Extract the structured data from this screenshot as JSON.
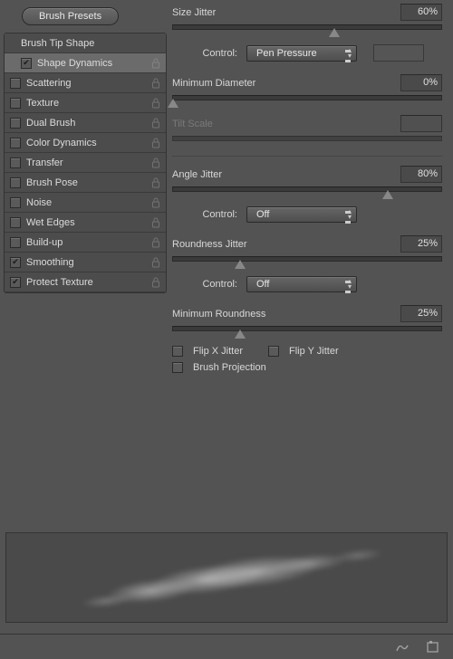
{
  "header": {
    "brush_presets": "Brush Presets"
  },
  "sidebar": {
    "tip_shape": "Brush Tip Shape",
    "items": [
      {
        "label": "Shape Dynamics",
        "checked": true,
        "selected": true,
        "lockable": true
      },
      {
        "label": "Scattering",
        "checked": false,
        "selected": false,
        "lockable": true
      },
      {
        "label": "Texture",
        "checked": false,
        "selected": false,
        "lockable": true
      },
      {
        "label": "Dual Brush",
        "checked": false,
        "selected": false,
        "lockable": true
      },
      {
        "label": "Color Dynamics",
        "checked": false,
        "selected": false,
        "lockable": true
      },
      {
        "label": "Transfer",
        "checked": false,
        "selected": false,
        "lockable": true
      },
      {
        "label": "Brush Pose",
        "checked": false,
        "selected": false,
        "lockable": true
      },
      {
        "label": "Noise",
        "checked": false,
        "selected": false,
        "lockable": true
      },
      {
        "label": "Wet Edges",
        "checked": false,
        "selected": false,
        "lockable": true
      },
      {
        "label": "Build-up",
        "checked": false,
        "selected": false,
        "lockable": true
      },
      {
        "label": "Smoothing",
        "checked": true,
        "selected": false,
        "lockable": true
      },
      {
        "label": "Protect Texture",
        "checked": true,
        "selected": false,
        "lockable": true
      }
    ]
  },
  "settings": {
    "size_jitter": {
      "label": "Size Jitter",
      "value": "60%",
      "slider": 60
    },
    "control1": {
      "label": "Control:",
      "value": "Pen Pressure"
    },
    "min_diameter": {
      "label": "Minimum Diameter",
      "value": "0%",
      "slider": 0
    },
    "tilt_scale": {
      "label": "Tilt Scale",
      "value": "",
      "slider": 0,
      "disabled": true
    },
    "angle_jitter": {
      "label": "Angle Jitter",
      "value": "80%",
      "slider": 80
    },
    "control2": {
      "label": "Control:",
      "value": "Off"
    },
    "roundness_jitter": {
      "label": "Roundness Jitter",
      "value": "25%",
      "slider": 25
    },
    "control3": {
      "label": "Control:",
      "value": "Off"
    },
    "min_roundness": {
      "label": "Minimum Roundness",
      "value": "25%",
      "slider": 25
    },
    "flip_x": {
      "label": "Flip X Jitter",
      "checked": false
    },
    "flip_y": {
      "label": "Flip Y Jitter",
      "checked": false
    },
    "brush_projection": {
      "label": "Brush Projection",
      "checked": false
    }
  }
}
